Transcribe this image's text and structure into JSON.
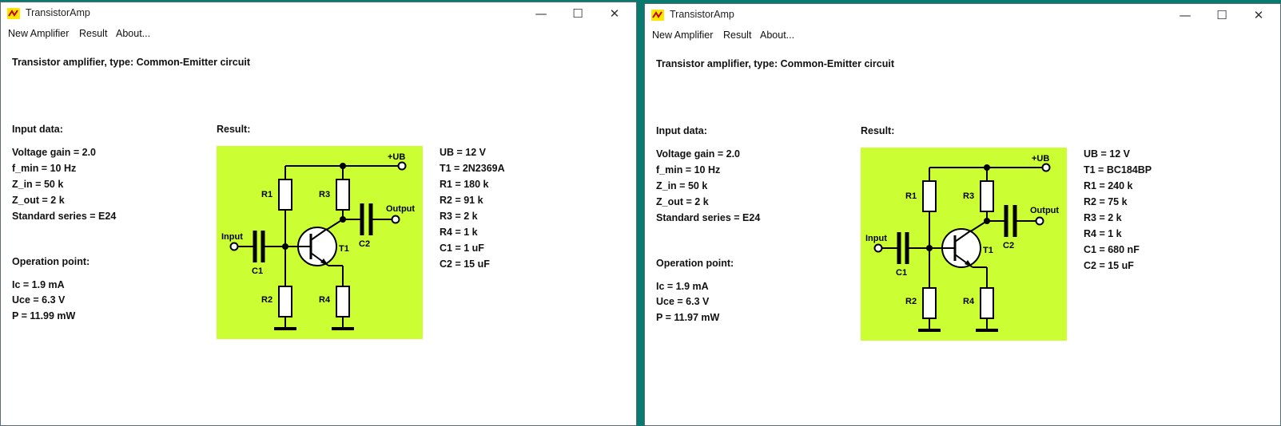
{
  "windows": [
    {
      "title": "TransistorAmp",
      "menu": [
        "New Amplifier",
        "Result",
        "About..."
      ],
      "heading": "Transistor amplifier, type: Common-Emitter circuit",
      "input_label": "Input data:",
      "inputs": [
        "Voltage gain = 2.0",
        "f_min = 10 Hz",
        "Z_in = 50 k",
        "Z_out = 2 k",
        "Standard series = E24"
      ],
      "operation_label": "Operation point:",
      "operation": [
        "Ic = 1.9 mA",
        "Uce = 6.3 V",
        "P = 11.99 mW"
      ],
      "result_label": "Result:",
      "results": [
        "UB = 12 V",
        "T1 = 2N2369A",
        "R1 = 180 k",
        "R2 = 91 k",
        "R3 = 2 k",
        "R4 = 1 k",
        "C1 = 1 uF",
        "C2 = 15 uF"
      ],
      "schematic_labels": {
        "ub": "+UB",
        "r1": "R1",
        "r2": "R2",
        "r3": "R3",
        "r4": "R4",
        "c1": "C1",
        "c2": "C2",
        "t1": "T1",
        "input": "Input",
        "output": "Output"
      }
    },
    {
      "title": "TransistorAmp",
      "menu": [
        "New Amplifier",
        "Result",
        "About..."
      ],
      "heading": "Transistor amplifier, type: Common-Emitter circuit",
      "input_label": "Input data:",
      "inputs": [
        "Voltage gain = 2.0",
        "f_min = 10 Hz",
        "Z_in = 50 k",
        "Z_out = 2 k",
        "Standard series = E24"
      ],
      "operation_label": "Operation point:",
      "operation": [
        "Ic = 1.9 mA",
        "Uce = 6.3 V",
        "P = 11.97 mW"
      ],
      "result_label": "Result:",
      "results": [
        "UB = 12 V",
        "T1 = BC184BP",
        "R1 = 240 k",
        "R2 = 75 k",
        "R3 = 2 k",
        "R4 = 1 k",
        "C1 = 680 nF",
        "C2 = 15 uF"
      ],
      "schematic_labels": {
        "ub": "+UB",
        "r1": "R1",
        "r2": "R2",
        "r3": "R3",
        "r4": "R4",
        "c1": "C1",
        "c2": "C2",
        "t1": "T1",
        "input": "Input",
        "output": "Output"
      }
    }
  ],
  "window_controls": {
    "minimize": "—",
    "maximize": "☐",
    "close": "✕"
  },
  "colors": {
    "schematic_bg": "#ccff33",
    "wire": "#000000",
    "desktop": "#0b7a6e"
  },
  "icons": {
    "app": "transistor-app-icon"
  }
}
